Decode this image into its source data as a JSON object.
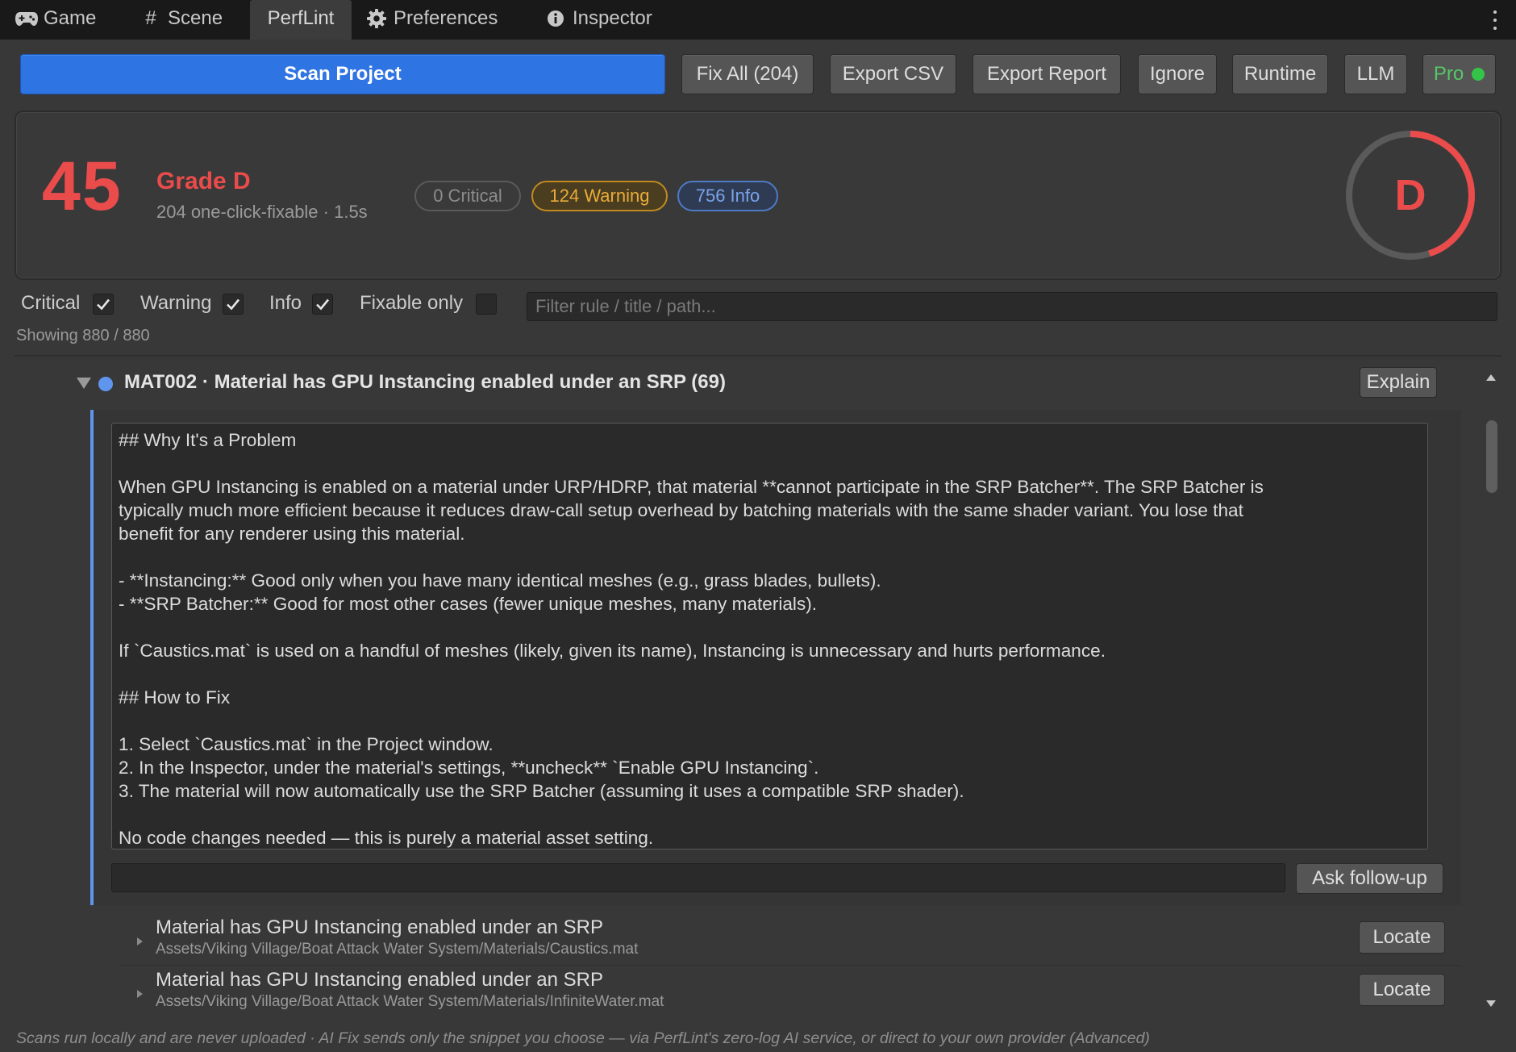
{
  "tabs": [
    {
      "label": "Game",
      "icon": "gamepad-icon"
    },
    {
      "label": "Scene",
      "icon": "grid-icon"
    },
    {
      "label": "PerfLint",
      "icon": ""
    },
    {
      "label": "Preferences",
      "icon": "gear-icon"
    },
    {
      "label": "Inspector",
      "icon": "info-icon"
    }
  ],
  "toolbar": {
    "scan": "Scan Project",
    "fix_all": "Fix All (204)",
    "export_csv": "Export CSV",
    "export_report": "Export Report",
    "ignore": "Ignore",
    "runtime": "Runtime",
    "llm": "LLM",
    "pro": "Pro"
  },
  "summary": {
    "score": "45",
    "grade": "Grade D",
    "subtitle": "204 one-click-fixable · 1.5s",
    "critical": "0 Critical",
    "warning": "124 Warning",
    "info": "756 Info",
    "gauge_letter": "D",
    "gauge_fraction": 0.45,
    "colors": {
      "bad": "#ea4b4b",
      "warning": "#e9ac3a",
      "info": "#7aa3ec",
      "accent": "#2f74e3",
      "pro": "#34c548"
    }
  },
  "filters": {
    "critical": {
      "label": "Critical",
      "checked": true
    },
    "warning": {
      "label": "Warning",
      "checked": true
    },
    "info": {
      "label": "Info",
      "checked": true
    },
    "fixable": {
      "label": "Fixable only",
      "checked": false
    },
    "search_placeholder": "Filter rule / title / path...",
    "showing": "Showing 880 / 880"
  },
  "rule": {
    "title": "MAT002 · Material has GPU Instancing enabled under an SRP (69)",
    "explain_label": "Explain",
    "explanation_lines": [
      "## Why It's a Problem",
      "",
      "When GPU Instancing is enabled on a material under URP/HDRP, that material **cannot participate in the SRP Batcher**. The SRP Batcher is",
      "typically much more efficient because it reduces draw-call setup overhead by batching materials with the same shader variant. You lose that",
      "benefit for any renderer using this material.",
      "",
      "- **Instancing:** Good only when you have many identical meshes (e.g., grass blades, bullets).",
      "- **SRP Batcher:** Good for most other cases (fewer unique meshes, many materials).",
      "",
      "If `Caustics.mat` is used on a handful of meshes (likely, given its name), Instancing is unnecessary and hurts performance.",
      "",
      "## How to Fix",
      "",
      "1. Select `Caustics.mat` in the Project window.",
      "2. In the Inspector, under the material's settings, **uncheck** `Enable GPU Instancing`.",
      "3. The material will now automatically use the SRP Batcher (assuming it uses a compatible SRP shader).",
      "",
      "No code changes needed — this is purely a material asset setting."
    ],
    "followup_value": "",
    "followup_label": "Ask follow-up",
    "issues": [
      {
        "title": "Material has GPU Instancing enabled under an SRP",
        "path": "Assets/Viking Village/Boat Attack Water System/Materials/Caustics.mat",
        "action": "Locate"
      },
      {
        "title": "Material has GPU Instancing enabled under an SRP",
        "path": "Assets/Viking Village/Boat Attack Water System/Materials/InfiniteWater.mat",
        "action": "Locate"
      }
    ]
  },
  "footer": "Scans run locally and are never uploaded · AI Fix sends only the snippet you choose — via PerfLint's zero-log AI service, or direct to your own provider (Advanced)"
}
